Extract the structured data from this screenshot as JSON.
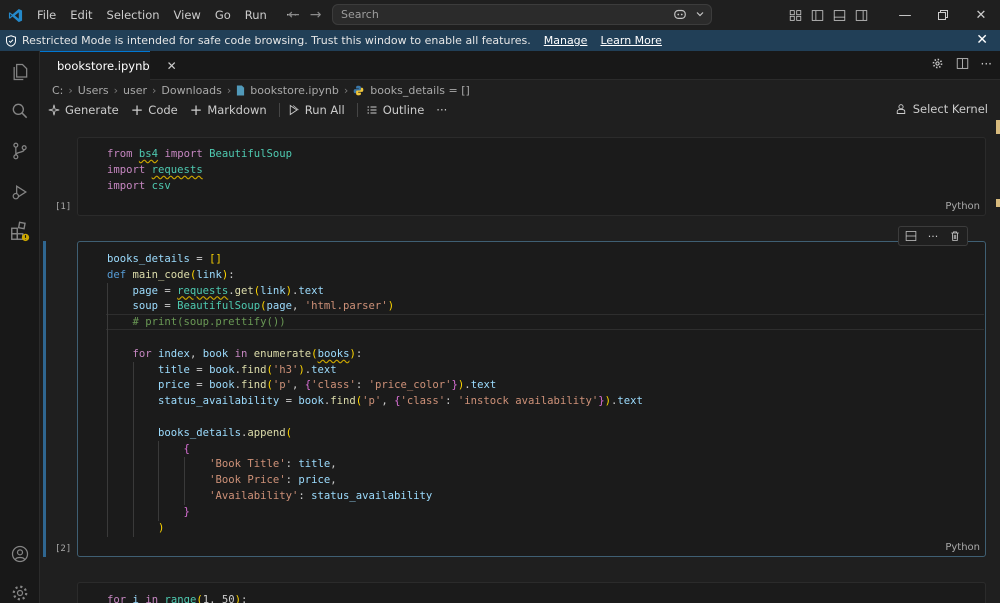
{
  "titlebar": {
    "menu": [
      "File",
      "Edit",
      "Selection",
      "View",
      "Go",
      "Run"
    ],
    "more": "···",
    "search_placeholder": "Search"
  },
  "banner": {
    "message": "Restricted Mode is intended for safe code browsing. Trust this window to enable all features.",
    "manage": "Manage",
    "learn_more": "Learn More"
  },
  "tab": {
    "label": "bookstore.ipynb"
  },
  "breadcrumb": {
    "parts": [
      "C:",
      "Users",
      "user",
      "Downloads"
    ],
    "file": "bookstore.ipynb",
    "symbol": "books_details = []"
  },
  "toolbar": {
    "generate": "Generate",
    "code": "Code",
    "markdown": "Markdown",
    "run_all": "Run All",
    "outline": "Outline",
    "more": "···",
    "select_kernel": "Select Kernel"
  },
  "cells": [
    {
      "exec_count": "[1]",
      "language": "Python"
    },
    {
      "exec_count": "[2]",
      "language": "Python"
    }
  ],
  "colors": {
    "accent": "#0078d4",
    "banner": "#213f57",
    "warning": "#cca700"
  }
}
